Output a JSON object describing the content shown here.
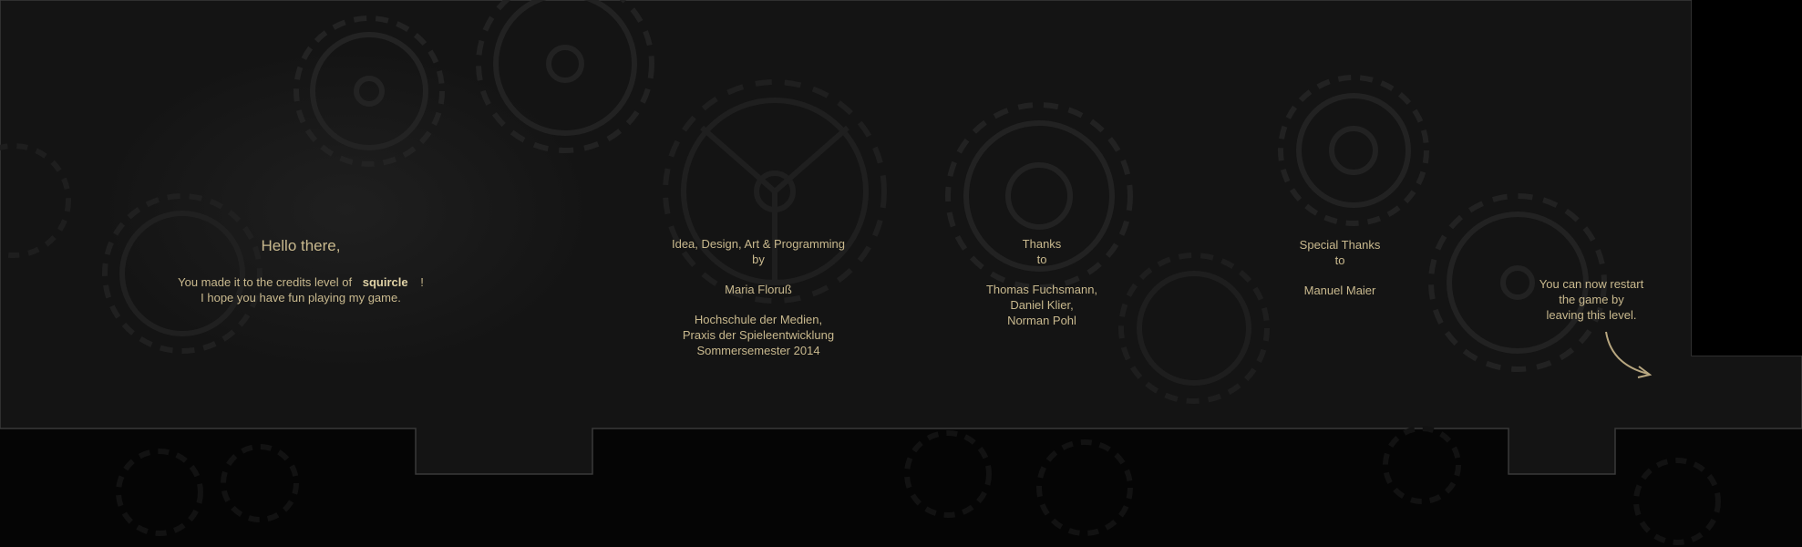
{
  "greeting": {
    "title": "Hello there,",
    "line1_prefix": "You made it to the credits level of",
    "game_name": "squircle",
    "line1_suffix": "!",
    "line2": "I hope you have fun playing my game."
  },
  "credits_main": {
    "role_line1": "Idea, Design, Art & Programming",
    "role_line2": "by",
    "author": "Maria Floruß",
    "school_line1": "Hochschule der Medien,",
    "school_line2": "Praxis der Spieleentwicklung",
    "school_line3": "Sommersemester 2014"
  },
  "thanks": {
    "line1": "Thanks",
    "line2": "to",
    "names": [
      "Thomas Fuchsmann,",
      "Daniel Klier,",
      "Norman Pohl"
    ]
  },
  "special_thanks": {
    "line1": "Special Thanks",
    "line2": "to",
    "name": "Manuel Maier"
  },
  "restart_hint": {
    "line1": "You can now restart",
    "line2": "the game by",
    "line3": "leaving this level."
  },
  "colors": {
    "text": "#c9b98e",
    "wall": "#141414",
    "void": "#050505",
    "gear": "#1c1c1c"
  },
  "icons": [
    "gear-icon",
    "curved-arrow-icon"
  ]
}
